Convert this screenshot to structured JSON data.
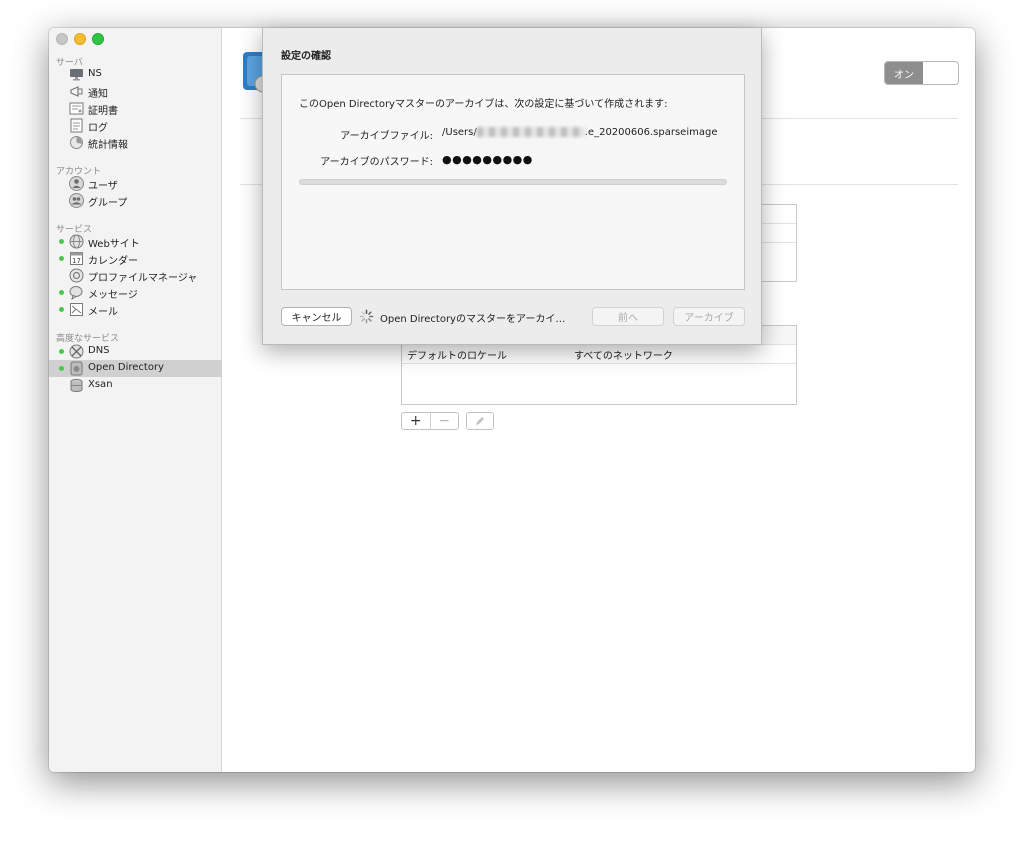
{
  "sidebar": {
    "sections": [
      {
        "title": "サーバ",
        "items": [
          {
            "label": "NS",
            "icon": "display-icon",
            "status": false
          },
          {
            "label": "通知",
            "icon": "megaphone-icon",
            "status": false
          },
          {
            "label": "証明書",
            "icon": "certificate-icon",
            "status": false
          },
          {
            "label": "ログ",
            "icon": "log-icon",
            "status": false
          },
          {
            "label": "統計情報",
            "icon": "stats-icon",
            "status": false
          }
        ]
      },
      {
        "title": "アカウント",
        "items": [
          {
            "label": "ユーザ",
            "icon": "user-icon",
            "status": false
          },
          {
            "label": "グループ",
            "icon": "group-icon",
            "status": false
          }
        ]
      },
      {
        "title": "サービス",
        "items": [
          {
            "label": "Webサイト",
            "icon": "globe-icon",
            "status": true
          },
          {
            "label": "カレンダー",
            "icon": "calendar-icon",
            "status": true
          },
          {
            "label": "プロファイルマネージャ",
            "icon": "profile-manager-icon",
            "status": false
          },
          {
            "label": "メッセージ",
            "icon": "messages-icon",
            "status": true
          },
          {
            "label": "メール",
            "icon": "mail-icon",
            "status": true
          }
        ]
      },
      {
        "title": "高度なサービス",
        "items": [
          {
            "label": "DNS",
            "icon": "dns-icon",
            "status": true
          },
          {
            "label": "Open Directory",
            "icon": "open-directory-icon",
            "status": true,
            "selected": true
          },
          {
            "label": "Xsan",
            "icon": "xsan-icon",
            "status": false
          }
        ]
      }
    ],
    "calendar_day": "17"
  },
  "content": {
    "toggle_label": "オン",
    "table_row": {
      "col1": "デフォルトのロケール",
      "col2": "すべてのネットワーク"
    },
    "add_button": "+",
    "remove_button": "−"
  },
  "dialog": {
    "title": "設定の確認",
    "intro": "このOpen Directoryマスターのアーカイブは、次の設定に基づいて作成されます:",
    "file_label": "アーカイブファイル:",
    "file_value_prefix": "/Users/",
    "file_value_suffix": ".e_20200606.sparseimage",
    "password_label": "アーカイブのパスワード:",
    "password_value": "●●●●●●●●●",
    "cancel_button": "キャンセル",
    "status": "Open Directoryのマスターをアーカイ…",
    "prev_button": "前へ",
    "archive_button": "アーカイブ"
  }
}
